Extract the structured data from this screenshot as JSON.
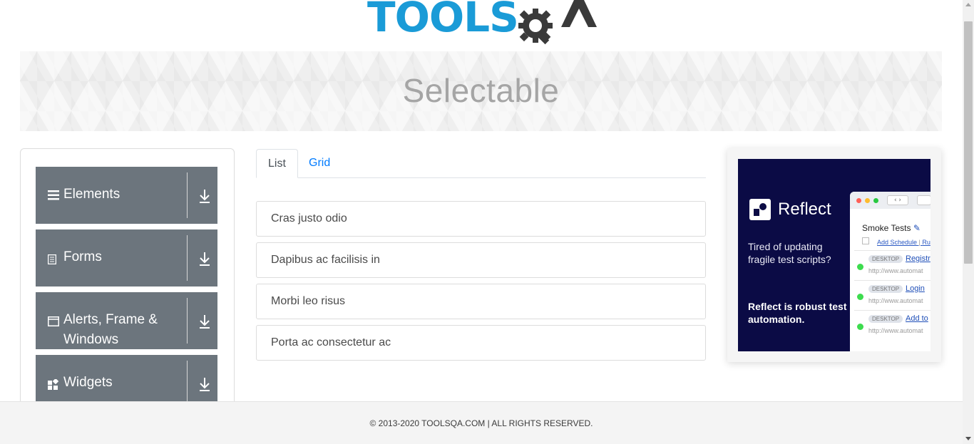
{
  "header": {
    "logo_part1": "TOOLS",
    "logo_part2": "QA"
  },
  "banner": {
    "title": "Selectable"
  },
  "sidebar": {
    "groups": [
      {
        "label": "Elements",
        "icon": "menu-icon"
      },
      {
        "label": "Forms",
        "icon": "document-icon"
      },
      {
        "label": "Alerts, Frame & Windows",
        "icon": "window-icon"
      },
      {
        "label": "Widgets",
        "icon": "widgets-icon"
      }
    ]
  },
  "tabs": [
    {
      "label": "List",
      "active": true
    },
    {
      "label": "Grid",
      "active": false
    }
  ],
  "list_items": [
    "Cras justo odio",
    "Dapibus ac facilisis in",
    "Morbi leo risus",
    "Porta ac consectetur ac"
  ],
  "ad": {
    "brand": "Reflect",
    "tagline": "Tired of updating fragile test scripts?",
    "cta": "Reflect is robust test automation.",
    "mock_title": "Smoke Tests",
    "mock_link": "Add Schedule",
    "mock_link2": "Ru",
    "rows": [
      {
        "badge": "DESKTOP",
        "link": "Registr",
        "url": "http://www.automat"
      },
      {
        "badge": "DESKTOP",
        "link": "Login",
        "url": "http://www.automat"
      },
      {
        "badge": "DESKTOP",
        "link": "Add to",
        "url": "http://www.automat"
      }
    ]
  },
  "footer": {
    "text": "© 2013-2020 TOOLSQA.COM | ALL RIGHTS RESERVED."
  },
  "colors": {
    "brand_blue": "#1a9bd7",
    "sidebar_group": "#6c757d",
    "link_blue": "#007bff",
    "ad_bg": "#0b0b45"
  }
}
